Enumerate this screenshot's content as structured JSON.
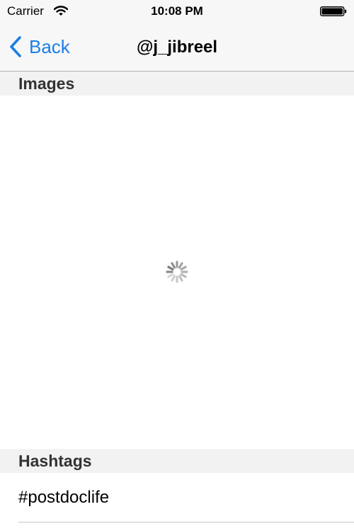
{
  "status_bar": {
    "carrier": "Carrier",
    "time": "10:08 PM",
    "icons": [
      "wifi-icon",
      "battery-icon"
    ]
  },
  "nav": {
    "back_label": "Back",
    "title": "@j_jibreel",
    "back_icon": "chevron-left-icon",
    "accent_color": "#1a7fe8"
  },
  "sections": {
    "images": {
      "header": "Images",
      "loading_icon": "activity-spinner-icon"
    },
    "hashtags": {
      "header": "Hashtags",
      "items": [
        {
          "label": "#postdoclife"
        }
      ]
    }
  }
}
